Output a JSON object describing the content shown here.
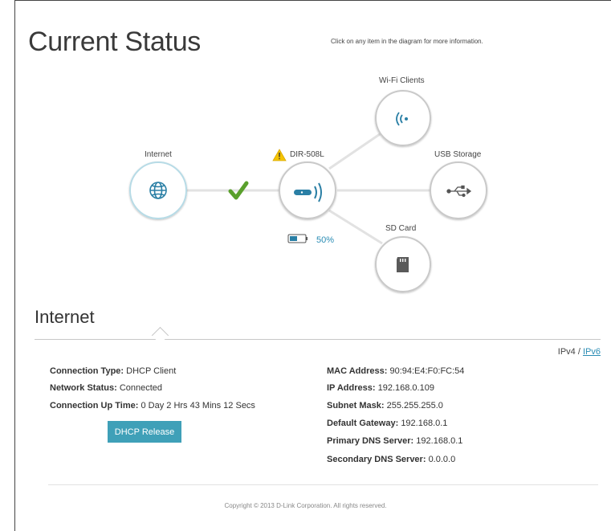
{
  "page": {
    "title": "Current Status",
    "hint": "Click on any item in the diagram for more information."
  },
  "diagram": {
    "internet_label": "Internet",
    "router_label": "DIR-508L",
    "wifi_label": "Wi-Fi Clients",
    "usb_label": "USB Storage",
    "sd_label": "SD Card",
    "battery_percent": "50%",
    "battery_level": 0.5,
    "connection_state": "connected",
    "router_warning": true
  },
  "internet": {
    "section_title": "Internet",
    "ipv4_label": "IPv4",
    "separator": "/",
    "ipv6_label": "IPv6",
    "connection_type_label": "Connection Type:",
    "connection_type": "DHCP Client",
    "network_status_label": "Network Status:",
    "network_status": "Connected",
    "uptime_label": "Connection Up Time:",
    "uptime": "0 Day 2 Hrs 43 Mins 12 Secs",
    "release_button": "DHCP Release",
    "mac_label": "MAC Address:",
    "mac": "90:94:E4:F0:FC:54",
    "ip_label": "IP Address:",
    "ip": "192.168.0.109",
    "subnet_label": "Subnet Mask:",
    "subnet": "255.255.255.0",
    "gateway_label": "Default Gateway:",
    "gateway": "192.168.0.1",
    "dns1_label": "Primary DNS Server:",
    "dns1": "192.168.0.1",
    "dns2_label": "Secondary DNS Server:",
    "dns2": "0.0.0.0"
  },
  "footer": {
    "copyright": "Copyright © 2013 D-Link Corporation. All rights reserved."
  },
  "colors": {
    "accent": "#2a8cb4",
    "button": "#3fa0b8",
    "check": "#5aa02c",
    "warning": "#f5c400"
  }
}
